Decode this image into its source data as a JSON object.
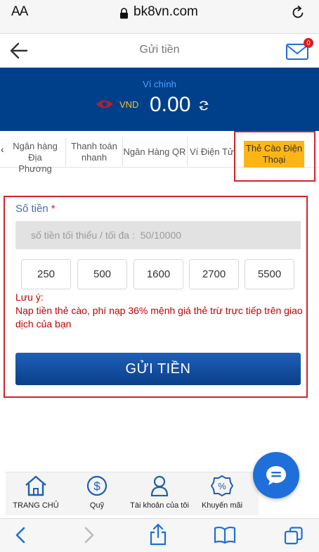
{
  "browser": {
    "aa_label": "AA",
    "url": "bk8vn.com"
  },
  "header": {
    "title": "Gửi tiền",
    "mail_badge": "0"
  },
  "wallet": {
    "label": "Ví chính",
    "currency": "VND",
    "amount": "0.00"
  },
  "tabs": [
    {
      "label_line1": "Ngân hàng Địa",
      "label_line2": "Phương"
    },
    {
      "label_line1": "Thanh toán",
      "label_line2": "nhanh"
    },
    {
      "label_line1": "Ngân Hàng QR",
      "label_line2": ""
    },
    {
      "label_line1": "Ví Điện Tử",
      "label_line2": ""
    },
    {
      "label_line1": "Thẻ Cào Điện",
      "label_line2": "Thoại"
    }
  ],
  "form": {
    "amount_label": "Số tiền",
    "required_mark": "*",
    "amount_placeholder": "số tiền tối thiểu / tối đa :  50/10000",
    "presets": [
      "250",
      "500",
      "1600",
      "2700",
      "5500"
    ],
    "note_label": "Lưu ý:",
    "note_text": "Nạp tiền thẻ cào, phí nạp 36% mệnh giá thẻ trừ trực tiếp trên giao dịch của bạn",
    "submit_label": "GỬI TIỀN"
  },
  "bottom_nav": [
    {
      "label": "TRANG CHỦ",
      "icon": "home-icon"
    },
    {
      "label": "Quỹ",
      "icon": "dollar-icon"
    },
    {
      "label": "Tài khoản của tôi",
      "icon": "user-icon"
    },
    {
      "label": "Khuyến mãi",
      "icon": "percent-icon"
    }
  ],
  "colors": {
    "brand_blue": "#003f8a",
    "accent_yellow": "#fdb515",
    "alert_red": "#d2232a"
  }
}
